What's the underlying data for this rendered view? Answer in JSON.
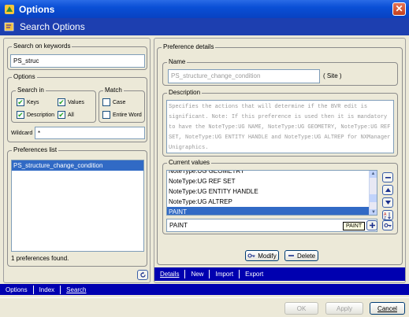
{
  "window": {
    "title": "Options",
    "close_glyph": "✕"
  },
  "header": {
    "title": "Search Options"
  },
  "search": {
    "group_label": "Search on keywords",
    "value": "PS_struc"
  },
  "options": {
    "group_label": "Options",
    "search_in": {
      "label": "Search in",
      "keys": {
        "label": "Keys",
        "checked": true
      },
      "values": {
        "label": "Values",
        "checked": true
      },
      "description": {
        "label": "Description",
        "checked": true
      },
      "all": {
        "label": "All",
        "checked": true
      }
    },
    "match": {
      "label": "Match",
      "case": {
        "label": "Case",
        "checked": false
      },
      "entire_word": {
        "label": "Entire Word",
        "checked": false
      }
    },
    "wildcard": {
      "label": "Wildcard",
      "value": "*"
    }
  },
  "preferences_list": {
    "group_label": "Preferences list",
    "items": [
      "PS_structure_change_condition"
    ],
    "selected_index": 0,
    "found_text": "1 preferences found."
  },
  "preference_details": {
    "group_label": "Preference details",
    "name": {
      "label": "Name",
      "value": "PS_structure_change_condition",
      "scope": "( Site )"
    },
    "description": {
      "label": "Description",
      "text": "Specifies the actions that will determine if the BVR edit is significant. Note: If this preference is used then it is mandatory to have the NoteType:UG NAME, NoteType:UG GEOMETRY, NoteType:UG REF SET, NoteType:UG ENTITY HANDLE and NoteType:UG ALTREP for NXManager Unigraphics."
    },
    "current_values": {
      "label": "Current values",
      "items": [
        "NoteType:UG GEOMETRY",
        "NoteType:UG REF SET",
        "NoteType:UG ENTITY HANDLE",
        "NoteType:UG ALTREP",
        "PAINT"
      ],
      "selected_index": 4,
      "edit_value": "PAINT",
      "tooltip": "PAINT"
    },
    "modify_label": "Modify",
    "delete_label": "Delete"
  },
  "right_tabs": [
    "Details",
    "New",
    "Import",
    "Export"
  ],
  "left_tabs": [
    "Options",
    "Index",
    "Search"
  ],
  "footer": {
    "ok": "OK",
    "apply": "Apply",
    "cancel": "Cancel"
  },
  "colors": {
    "title_bar": "#0a4fd6",
    "header_band": "#1d3fb0",
    "tab_bar": "#0000b0",
    "selection": "#316ac5"
  }
}
